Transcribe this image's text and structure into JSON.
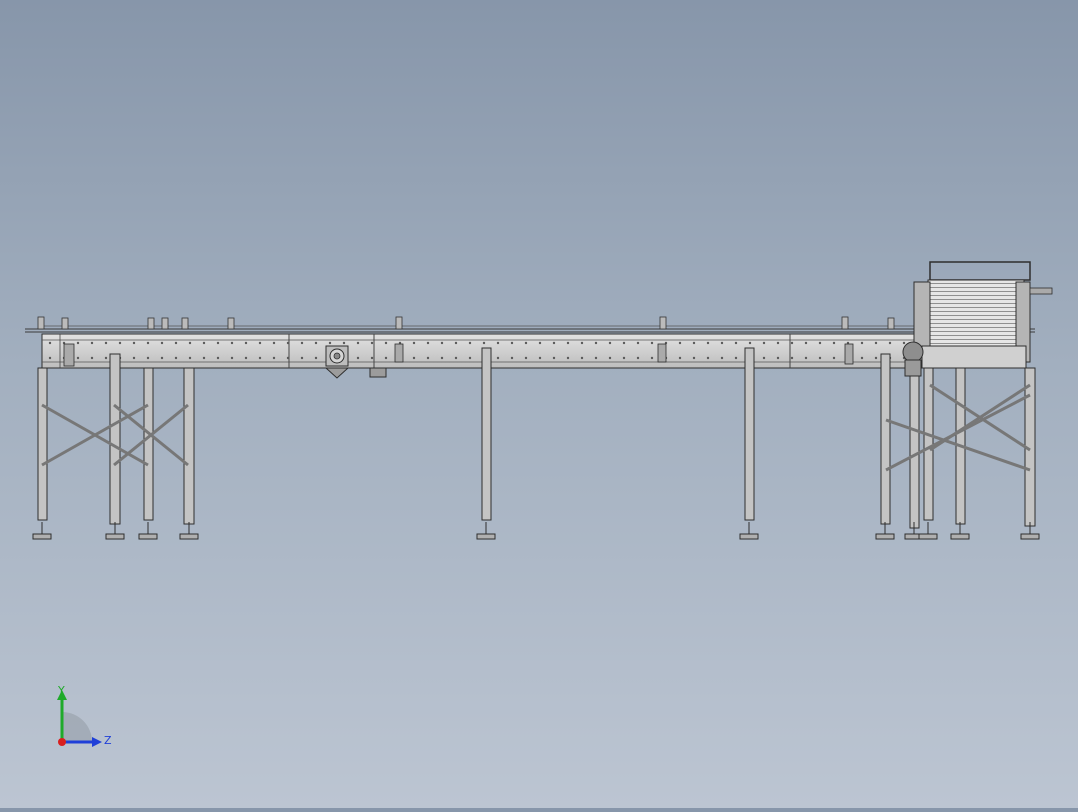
{
  "viewport": {
    "background_top": "#8796aa",
    "background_bottom": "#bcc5d2",
    "model_line_color": "#2e2e2e",
    "model_fill_color": "#c9c9c9",
    "model_shade_color": "#9a9a9a"
  },
  "triad": {
    "y_label": "Y",
    "z_label": "Z",
    "y_color": "#1faa2a",
    "z_color": "#1f3fd8",
    "x_color": "#d81f1f"
  }
}
